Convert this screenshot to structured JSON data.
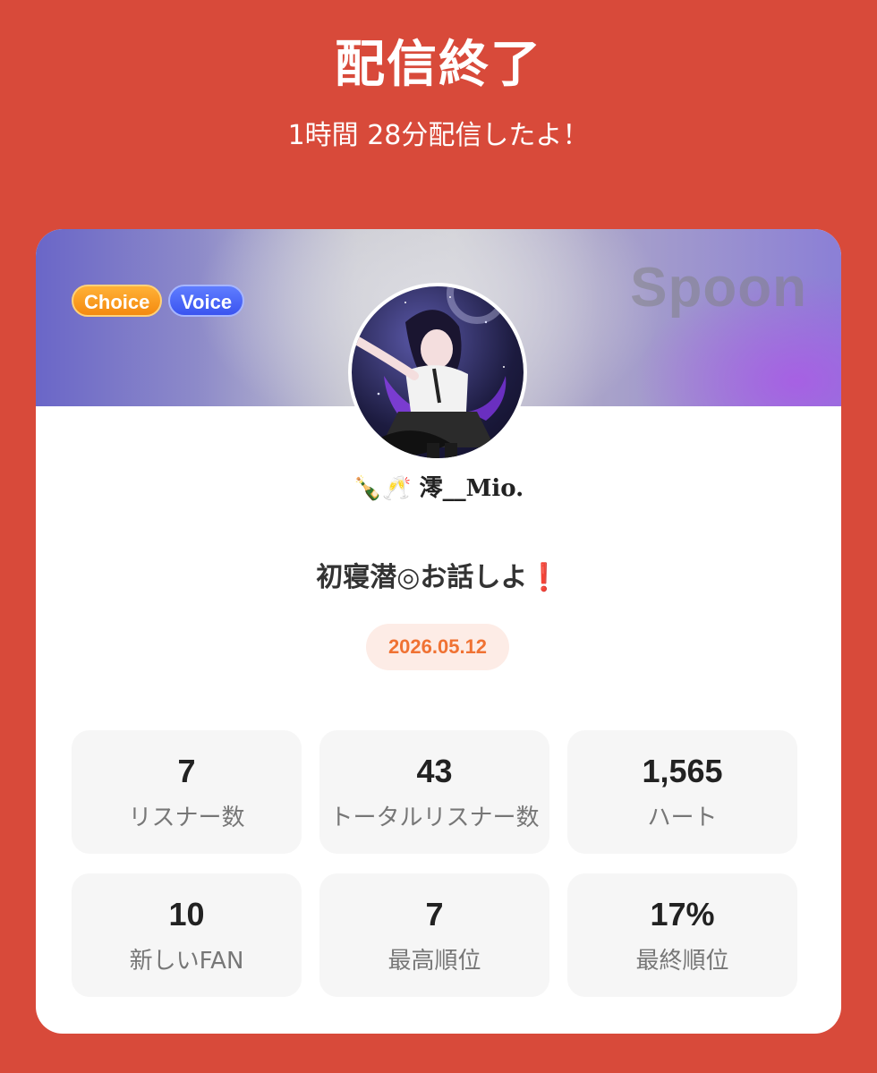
{
  "header": {
    "title": "配信終了",
    "subtitle": "1時間 28分配信したよ！"
  },
  "card": {
    "badges": {
      "choice": "Choice",
      "voice": "Voice"
    },
    "brand": "Spoon",
    "username": "🍾🥂 澪__Mio.",
    "broadcast_title": "初寝潜◎お話しよ❗️",
    "date": "2026.05.12",
    "stats": [
      {
        "value": "7",
        "label": "リスナー数"
      },
      {
        "value": "43",
        "label": "トータルリスナー数"
      },
      {
        "value": "1,565",
        "label": "ハート"
      },
      {
        "value": "10",
        "label": "新しいFAN"
      },
      {
        "value": "7",
        "label": "最高順位"
      },
      {
        "value": "17%",
        "label": "最終順位"
      }
    ]
  },
  "colors": {
    "background": "#d84a3a",
    "choice_badge": "#f48a10",
    "voice_badge": "#3a54f0",
    "date_text": "#f07233"
  }
}
